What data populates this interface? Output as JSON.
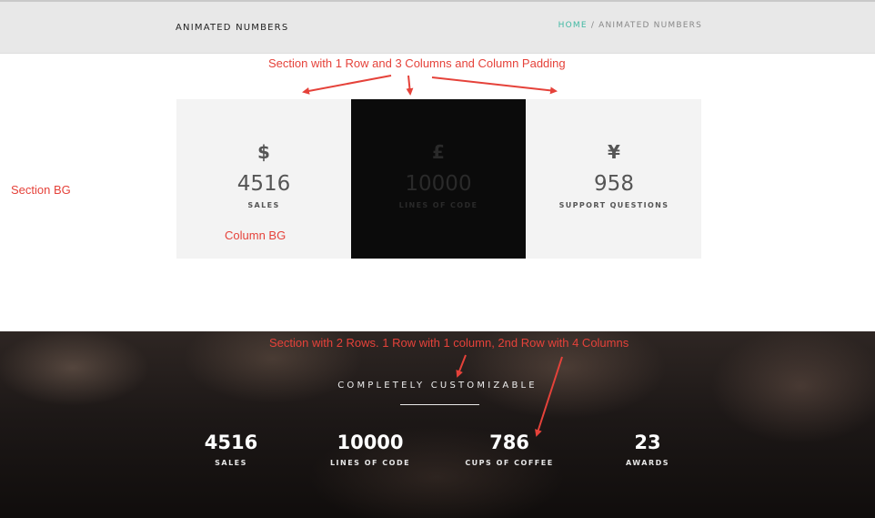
{
  "header": {
    "title": "ANIMATED NUMBERS",
    "breadcrumb": {
      "home": "HOME",
      "separator": " / ",
      "current": "ANIMATED NUMBERS"
    }
  },
  "annotations": {
    "top_section": "Section with 1 Row and 3 Columns and Column Padding",
    "section_bg": "Section BG",
    "column_bg": "Column BG",
    "bottom_section": "Section with 2 Rows. 1 Row with 1 column, 2nd Row with 4 Columns",
    "color": "#e5423a"
  },
  "columns": [
    {
      "symbol": "$",
      "value": "4516",
      "label": "SALES",
      "theme": "light"
    },
    {
      "symbol": "£",
      "value": "10000",
      "label": "LINES OF CODE",
      "theme": "dark"
    },
    {
      "symbol": "¥",
      "value": "958",
      "label": "SUPPORT QUESTIONS",
      "theme": "light"
    }
  ],
  "crowd_section": {
    "title": "COMPLETELY CUSTOMIZABLE",
    "stats": [
      {
        "value": "4516",
        "label": "SALES"
      },
      {
        "value": "10000",
        "label": "LINES OF CODE"
      },
      {
        "value": "786",
        "label": "CUPS OF COFFEE"
      },
      {
        "value": "23",
        "label": "AWARDS"
      }
    ]
  },
  "colors": {
    "accent": "#3fb8a2",
    "header_bg": "#e8e8e8",
    "column_light": "#f3f3f3",
    "column_dark": "#0b0b0b"
  }
}
